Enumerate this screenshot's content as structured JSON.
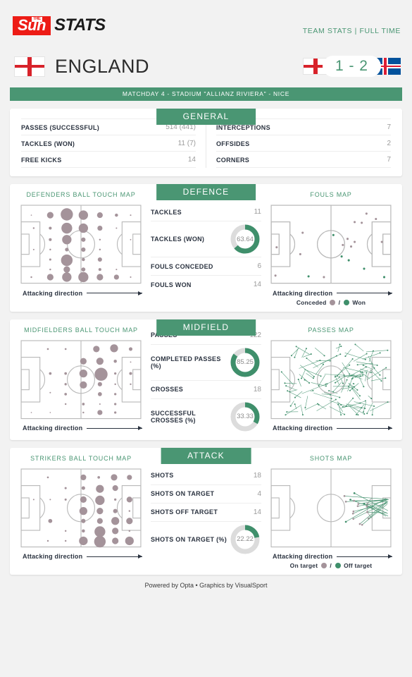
{
  "header": {
    "logo_the": "THE",
    "logo_sun": "Sun",
    "logo_stats": "STATS",
    "right_label": "TEAM STATS | FULL TIME"
  },
  "match": {
    "team_name": "ENGLAND",
    "score": "1 - 2",
    "home_flag": "england-flag",
    "away_flag": "iceland-flag",
    "matchday_band": "MATCHDAY 4 - STADIUM \"ALLIANZ RIVIERA\" - NICE"
  },
  "colors": {
    "green": "#4a9673",
    "green_light": "#3f8f6b",
    "track": "#dcdcdc",
    "touch_dot": "#a4939a",
    "pitch_line": "#b9b9b9",
    "red": "#ed1c16",
    "blue": "#02529c"
  },
  "general": {
    "title": "GENERAL",
    "left_rows": [
      {
        "label": "PASSES (SUCCESSFUL)",
        "value": "514 (441)"
      },
      {
        "label": "TACKLES (WON)",
        "value": "11 (7)"
      },
      {
        "label": "FREE KICKS",
        "value": "14"
      }
    ],
    "right_rows": [
      {
        "label": "INTERCEPTIONS",
        "value": "7"
      },
      {
        "label": "OFFSIDES",
        "value": "2"
      },
      {
        "label": "CORNERS",
        "value": "7"
      }
    ]
  },
  "defence": {
    "title": "DEFENCE",
    "left_map_title": "DEFENDERS BALL TOUCH MAP",
    "right_map_title": "FOULS MAP",
    "attacking_direction": "Attacking direction",
    "legend_conceded": "Conceded",
    "legend_sep": "/",
    "legend_won": "Won",
    "rows": [
      {
        "label": "TACKLES",
        "value": "11",
        "type": "plain"
      },
      {
        "label": "TACKLES (WON)",
        "value": "63.64",
        "type": "donut",
        "pct": 63.64
      },
      {
        "label": "FOULS CONCEDED",
        "value": "6",
        "type": "plain"
      },
      {
        "label": "FOULS WON",
        "value": "14",
        "type": "plain"
      }
    ]
  },
  "midfield": {
    "title": "MIDFIELD",
    "left_map_title": "MIDFIELDERS BALL TOUCH MAP",
    "right_map_title": "PASSES MAP",
    "attacking_direction": "Attacking direction",
    "rows": [
      {
        "label": "PASSES",
        "value": "122",
        "type": "plain"
      },
      {
        "label": "COMPLETED PASSES (%)",
        "value": "85.25",
        "type": "donut",
        "pct": 85.25
      },
      {
        "label": "CROSSES",
        "value": "18",
        "type": "plain"
      },
      {
        "label": "SUCCESSFUL CROSSES (%)",
        "value": "33.33",
        "type": "donut",
        "pct": 33.33
      }
    ]
  },
  "attack": {
    "title": "ATTACK",
    "left_map_title": "STRIKERS BALL TOUCH MAP",
    "right_map_title": "SHOTS MAP",
    "attacking_direction": "Attacking direction",
    "legend_on": "On target",
    "legend_sep": "/",
    "legend_off": "Off target",
    "rows": [
      {
        "label": "SHOTS",
        "value": "18",
        "type": "plain"
      },
      {
        "label": "SHOTS ON TARGET",
        "value": "4",
        "type": "plain"
      },
      {
        "label": "SHOTS OFF TARGET",
        "value": "14",
        "type": "plain"
      },
      {
        "label": "SHOTS ON TARGET (%)",
        "value": "22.22",
        "type": "donut",
        "pct": 22.22
      }
    ]
  },
  "footer": {
    "text": "Powered by Opta • Graphics by VisualSport"
  },
  "chart_data": [
    {
      "type": "scatter",
      "name": "defenders-ball-touch-map",
      "title": "DEFENDERS BALL TOUCH MAP",
      "xlabel": "pitch length (attacking direction →)",
      "ylabel": "pitch width",
      "xlim": [
        0,
        100
      ],
      "ylim": [
        0,
        100
      ],
      "points": [
        {
          "x": 8,
          "y": 88,
          "r": 0.8
        },
        {
          "x": 24,
          "y": 88,
          "r": 4.5
        },
        {
          "x": 38,
          "y": 89,
          "r": 8.5
        },
        {
          "x": 52,
          "y": 88,
          "r": 6.5
        },
        {
          "x": 66,
          "y": 88,
          "r": 4.0
        },
        {
          "x": 80,
          "y": 88,
          "r": 2.2
        },
        {
          "x": 92,
          "y": 88,
          "r": 1.0
        },
        {
          "x": 10,
          "y": 71,
          "r": 1.2
        },
        {
          "x": 24,
          "y": 71,
          "r": 2.0
        },
        {
          "x": 38,
          "y": 71,
          "r": 7.5
        },
        {
          "x": 52,
          "y": 71,
          "r": 6.5
        },
        {
          "x": 66,
          "y": 71,
          "r": 3.5
        },
        {
          "x": 80,
          "y": 71,
          "r": 1.0
        },
        {
          "x": 24,
          "y": 56,
          "r": 2.0
        },
        {
          "x": 38,
          "y": 56,
          "r": 6.5
        },
        {
          "x": 52,
          "y": 56,
          "r": 3.0
        },
        {
          "x": 66,
          "y": 56,
          "r": 1.2
        },
        {
          "x": 92,
          "y": 56,
          "r": 0.9
        },
        {
          "x": 10,
          "y": 43,
          "r": 1.0
        },
        {
          "x": 24,
          "y": 43,
          "r": 1.2
        },
        {
          "x": 38,
          "y": 43,
          "r": 2.5
        },
        {
          "x": 52,
          "y": 43,
          "r": 3.0
        },
        {
          "x": 66,
          "y": 43,
          "r": 1.2
        },
        {
          "x": 24,
          "y": 30,
          "r": 1.5
        },
        {
          "x": 38,
          "y": 29,
          "r": 8.0
        },
        {
          "x": 52,
          "y": 30,
          "r": 2.2
        },
        {
          "x": 66,
          "y": 30,
          "r": 3.0
        },
        {
          "x": 24,
          "y": 17,
          "r": 1.2
        },
        {
          "x": 38,
          "y": 17,
          "r": 4.5
        },
        {
          "x": 52,
          "y": 17,
          "r": 2.8
        },
        {
          "x": 66,
          "y": 17,
          "r": 2.0
        },
        {
          "x": 80,
          "y": 17,
          "r": 1.0
        },
        {
          "x": 8,
          "y": 7,
          "r": 1.2
        },
        {
          "x": 24,
          "y": 7,
          "r": 4.5
        },
        {
          "x": 38,
          "y": 7,
          "r": 6.5
        },
        {
          "x": 52,
          "y": 7,
          "r": 7.0
        },
        {
          "x": 66,
          "y": 7,
          "r": 4.5
        },
        {
          "x": 80,
          "y": 7,
          "r": 3.5
        },
        {
          "x": 92,
          "y": 7,
          "r": 1.0
        }
      ]
    },
    {
      "type": "scatter",
      "name": "fouls-map",
      "title": "FOULS MAP",
      "series": [
        {
          "name": "Conceded",
          "color": "#a4939a",
          "points": [
            {
              "x": 80,
              "y": 90
            },
            {
              "x": 88,
              "y": 83
            },
            {
              "x": 70,
              "y": 79
            },
            {
              "x": 76,
              "y": 78
            },
            {
              "x": 26,
              "y": 65
            },
            {
              "x": 64,
              "y": 57
            },
            {
              "x": 70,
              "y": 53
            },
            {
              "x": 60,
              "y": 49
            },
            {
              "x": 67,
              "y": 47
            },
            {
              "x": 24,
              "y": 37
            },
            {
              "x": 4,
              "y": 46
            },
            {
              "x": 93,
              "y": 53
            },
            {
              "x": 3,
              "y": 9
            },
            {
              "x": 44,
              "y": 7
            }
          ]
        },
        {
          "name": "Won",
          "color": "#3f8f6b",
          "points": [
            {
              "x": 52,
              "y": 62
            },
            {
              "x": 59,
              "y": 34
            },
            {
              "x": 65,
              "y": 29
            },
            {
              "x": 78,
              "y": 18
            },
            {
              "x": 31,
              "y": 8
            },
            {
              "x": 95,
              "y": 7
            }
          ]
        }
      ]
    },
    {
      "type": "scatter",
      "name": "midfielders-ball-touch-map",
      "title": "MIDFIELDERS BALL TOUCH MAP",
      "points": [
        {
          "x": 22,
          "y": 90,
          "r": 1.3
        },
        {
          "x": 37,
          "y": 90,
          "r": 1.3
        },
        {
          "x": 63,
          "y": 90,
          "r": 4.5
        },
        {
          "x": 78,
          "y": 91,
          "r": 5.5
        },
        {
          "x": 92,
          "y": 90,
          "r": 2.5
        },
        {
          "x": 52,
          "y": 74,
          "r": 4.5
        },
        {
          "x": 66,
          "y": 74,
          "r": 5.0
        },
        {
          "x": 79,
          "y": 74,
          "r": 2.2
        },
        {
          "x": 92,
          "y": 73,
          "r": 0.9
        },
        {
          "x": 24,
          "y": 58,
          "r": 1.8
        },
        {
          "x": 37,
          "y": 58,
          "r": 1.8
        },
        {
          "x": 52,
          "y": 58,
          "r": 5.5
        },
        {
          "x": 67,
          "y": 57,
          "r": 9.0
        },
        {
          "x": 79,
          "y": 58,
          "r": 1.6
        },
        {
          "x": 92,
          "y": 58,
          "r": 2.0
        },
        {
          "x": 37,
          "y": 44,
          "r": 1.6
        },
        {
          "x": 52,
          "y": 43,
          "r": 5.0
        },
        {
          "x": 66,
          "y": 44,
          "r": 3.0
        },
        {
          "x": 79,
          "y": 44,
          "r": 1.2
        },
        {
          "x": 92,
          "y": 44,
          "r": 1.2
        },
        {
          "x": 24,
          "y": 33,
          "r": 1.0
        },
        {
          "x": 37,
          "y": 31,
          "r": 1.8
        },
        {
          "x": 66,
          "y": 31,
          "r": 2.8
        },
        {
          "x": 79,
          "y": 31,
          "r": 1.6
        },
        {
          "x": 37,
          "y": 18,
          "r": 1.2
        },
        {
          "x": 52,
          "y": 18,
          "r": 1.8
        },
        {
          "x": 66,
          "y": 18,
          "r": 1.0
        },
        {
          "x": 79,
          "y": 18,
          "r": 1.6
        },
        {
          "x": 8,
          "y": 7,
          "r": 0.8
        },
        {
          "x": 24,
          "y": 7,
          "r": 0.8
        },
        {
          "x": 52,
          "y": 7,
          "r": 1.2
        },
        {
          "x": 66,
          "y": 7,
          "r": 3.5
        },
        {
          "x": 79,
          "y": 7,
          "r": 1.6
        }
      ]
    },
    {
      "type": "line",
      "name": "passes-map",
      "title": "PASSES MAP",
      "note": "Dense network of 122 pass arrows concentrated in central midfield"
    },
    {
      "type": "scatter",
      "name": "strikers-ball-touch-map",
      "title": "STRIKERS BALL TOUCH MAP",
      "points": [
        {
          "x": 22,
          "y": 90,
          "r": 1.3
        },
        {
          "x": 52,
          "y": 90,
          "r": 4.0
        },
        {
          "x": 65,
          "y": 90,
          "r": 1.8
        },
        {
          "x": 78,
          "y": 90,
          "r": 4.5
        },
        {
          "x": 91,
          "y": 90,
          "r": 3.5
        },
        {
          "x": 37,
          "y": 76,
          "r": 1.5
        },
        {
          "x": 52,
          "y": 76,
          "r": 2.5
        },
        {
          "x": 66,
          "y": 75,
          "r": 5.5
        },
        {
          "x": 79,
          "y": 76,
          "r": 4.0
        },
        {
          "x": 37,
          "y": 61,
          "r": 1.5
        },
        {
          "x": 52,
          "y": 61,
          "r": 4.5
        },
        {
          "x": 66,
          "y": 60,
          "r": 6.5
        },
        {
          "x": 79,
          "y": 61,
          "r": 1.6
        },
        {
          "x": 91,
          "y": 61,
          "r": 4.0
        },
        {
          "x": 10,
          "y": 61,
          "r": 1.0
        },
        {
          "x": 24,
          "y": 61,
          "r": 1.0
        },
        {
          "x": 52,
          "y": 46,
          "r": 5.5
        },
        {
          "x": 66,
          "y": 46,
          "r": 4.5
        },
        {
          "x": 79,
          "y": 46,
          "r": 3.0
        },
        {
          "x": 91,
          "y": 46,
          "r": 1.2
        },
        {
          "x": 24,
          "y": 33,
          "r": 2.8
        },
        {
          "x": 52,
          "y": 33,
          "r": 3.0
        },
        {
          "x": 66,
          "y": 33,
          "r": 4.0
        },
        {
          "x": 79,
          "y": 33,
          "r": 5.5
        },
        {
          "x": 91,
          "y": 33,
          "r": 4.5
        },
        {
          "x": 37,
          "y": 20,
          "r": 1.2
        },
        {
          "x": 52,
          "y": 20,
          "r": 2.2
        },
        {
          "x": 66,
          "y": 19,
          "r": 7.5
        },
        {
          "x": 79,
          "y": 20,
          "r": 4.5
        },
        {
          "x": 91,
          "y": 20,
          "r": 1.2
        },
        {
          "x": 22,
          "y": 7,
          "r": 1.2
        },
        {
          "x": 37,
          "y": 7,
          "r": 1.2
        },
        {
          "x": 52,
          "y": 7,
          "r": 6.0
        },
        {
          "x": 66,
          "y": 6,
          "r": 8.0
        },
        {
          "x": 79,
          "y": 7,
          "r": 4.5
        },
        {
          "x": 91,
          "y": 7,
          "r": 6.0
        }
      ]
    },
    {
      "type": "line",
      "name": "shots-map",
      "title": "SHOTS MAP",
      "note": "18 shot trajectories converging on the right-hand goal; 4 on target, 14 off target"
    }
  ]
}
